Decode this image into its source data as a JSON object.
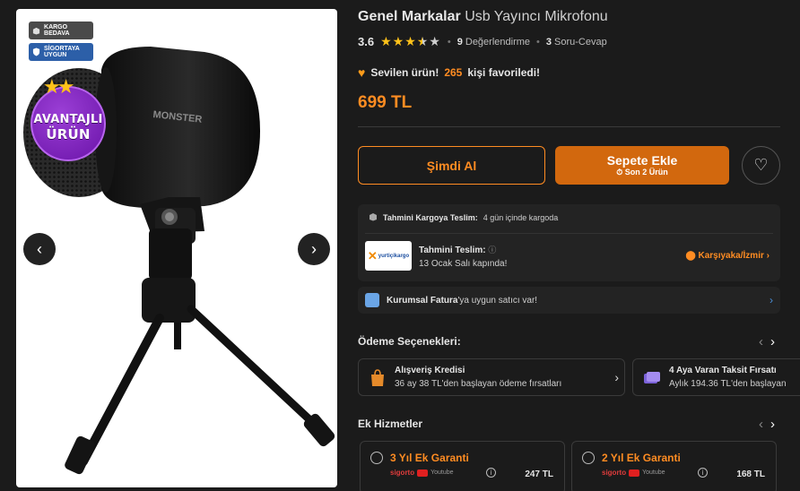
{
  "badges": {
    "cargo": "KARGO BEDAVA",
    "insurance": "SİGORTAYA UYGUN"
  },
  "advantage": {
    "line1": "AVANTAJLI",
    "line2": "ÜRÜN"
  },
  "product": {
    "brand": "Genel Markalar",
    "name": "Usb Yayıncı Mikrofonu",
    "image_logo_text": "MONSTER"
  },
  "rating": {
    "score": "3.6",
    "stars": 3.6,
    "reviews_count": "9",
    "reviews_label": "Değerlendirme",
    "qa_count": "3",
    "qa_label": "Soru-Cevap"
  },
  "favorite": {
    "prefix": "Sevilen ürün!",
    "count": "265",
    "suffix": "kişi favoriledi!"
  },
  "price": "699 TL",
  "actions": {
    "buy_now": "Şimdi Al",
    "add_to_cart": "Sepete Ekle",
    "cart_note": "Son 2 Ürün"
  },
  "delivery": {
    "cargo_label": "Tahmini Kargoya Teslim:",
    "cargo_value": "4 gün içinde kargoda",
    "carrier_logo": "yurtiçikargo",
    "est_label": "Tahmini Teslim:",
    "est_value": "13 Ocak Salı kapında!",
    "location": "Karşıyaka/İzmir"
  },
  "corporate": {
    "bold": "Kurumsal Fatura",
    "rest": "'ya uygun satıcı var!"
  },
  "payment": {
    "title": "Ödeme Seçenekleri:",
    "cards": [
      {
        "title": "Alışveriş Kredisi",
        "subtitle": "36 ay 38 TL'den başlayan ödeme fırsatları"
      },
      {
        "title": "4 Aya Varan Taksit Fırsatı",
        "subtitle": "Aylık 194.36 TL'den başlayan"
      }
    ]
  },
  "extra_services": {
    "title": "Ek Hizmetler",
    "items": [
      {
        "title": "3 Yıl Ek Garanti",
        "price": "247 TL",
        "partner1": "sigorto",
        "partner2": "Youtube"
      },
      {
        "title": "2 Yıl Ek Garanti",
        "price": "168 TL",
        "partner1": "sigorto",
        "partner2": "Youtube"
      }
    ]
  },
  "colors": {
    "accent": "#ff8c22",
    "cart_button": "#d2680e",
    "background": "#1b1b1b",
    "panel": "#232323"
  }
}
